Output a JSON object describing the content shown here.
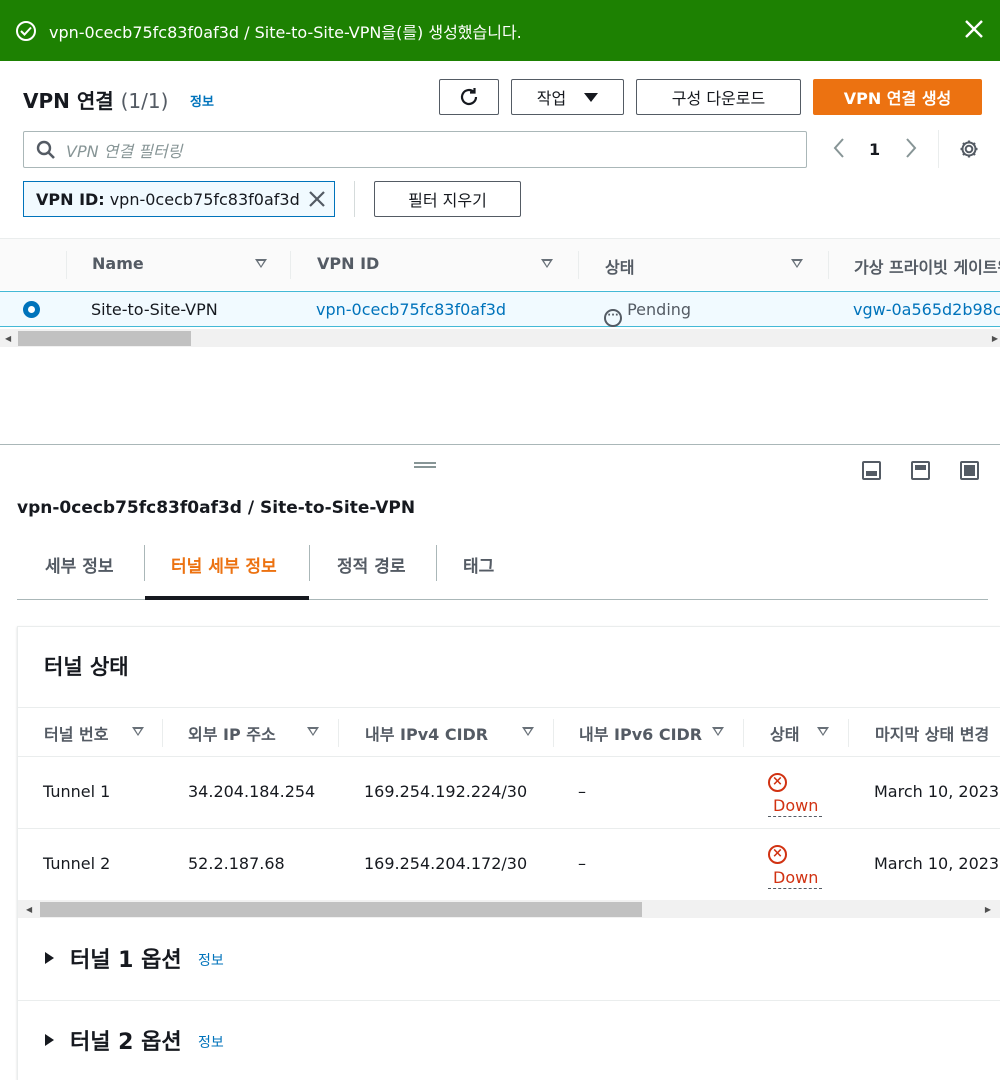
{
  "flash": {
    "message": "vpn-0cecb75fc83f0af3d / Site-to-Site-VPN을(를) 생성했습니다."
  },
  "header": {
    "title": "VPN 연결",
    "count": "(1/1)",
    "info": "정보",
    "actions_label": "작업",
    "download_label": "구성 다운로드",
    "create_label": "VPN 연결 생성"
  },
  "filter": {
    "placeholder": "VPN 연결 필터링",
    "token_key": "VPN ID:",
    "token_value": "vpn-0cecb75fc83f0af3d",
    "clear_label": "필터 지우기"
  },
  "pagination": {
    "current_page": "1"
  },
  "vpn_table": {
    "columns": [
      "Name",
      "VPN ID",
      "상태",
      "가상 프라이빗 게이트웨이"
    ],
    "rows": [
      {
        "name": "Site-to-Site-VPN",
        "vpn_id": "vpn-0cecb75fc83f0af3d",
        "state": "Pending",
        "vgw": "vgw-0a565d2b98c"
      }
    ]
  },
  "detail": {
    "title": "vpn-0cecb75fc83f0af3d / Site-to-Site-VPN",
    "tabs": [
      "세부 정보",
      "터널 세부 정보",
      "정적 경로",
      "태그"
    ],
    "active_tab": "터널 세부 정보",
    "tunnel_section_title": "터널 상태",
    "tunnel_columns": [
      "터널 번호",
      "외부 IP 주소",
      "내부 IPv4 CIDR",
      "내부 IPv6 CIDR",
      "상태",
      "마지막 상태 변경"
    ],
    "tunnels": [
      {
        "number": "Tunnel 1",
        "outside_ip": "34.204.184.254",
        "inside_ipv4": "169.254.192.224/30",
        "inside_ipv6": "–",
        "status": "Down",
        "last_change": "March 10, 2023"
      },
      {
        "number": "Tunnel 2",
        "outside_ip": "52.2.187.68",
        "inside_ipv4": "169.254.204.172/30",
        "inside_ipv6": "–",
        "status": "Down",
        "last_change": "March 10, 2023"
      }
    ],
    "tunnel1_options": "터널 1 옵션",
    "tunnel2_options": "터널 2 옵션",
    "info": "정보"
  },
  "colors": {
    "success": "#1d8102",
    "primary": "#ec7211",
    "link": "#0073bb",
    "error": "#d13212"
  }
}
